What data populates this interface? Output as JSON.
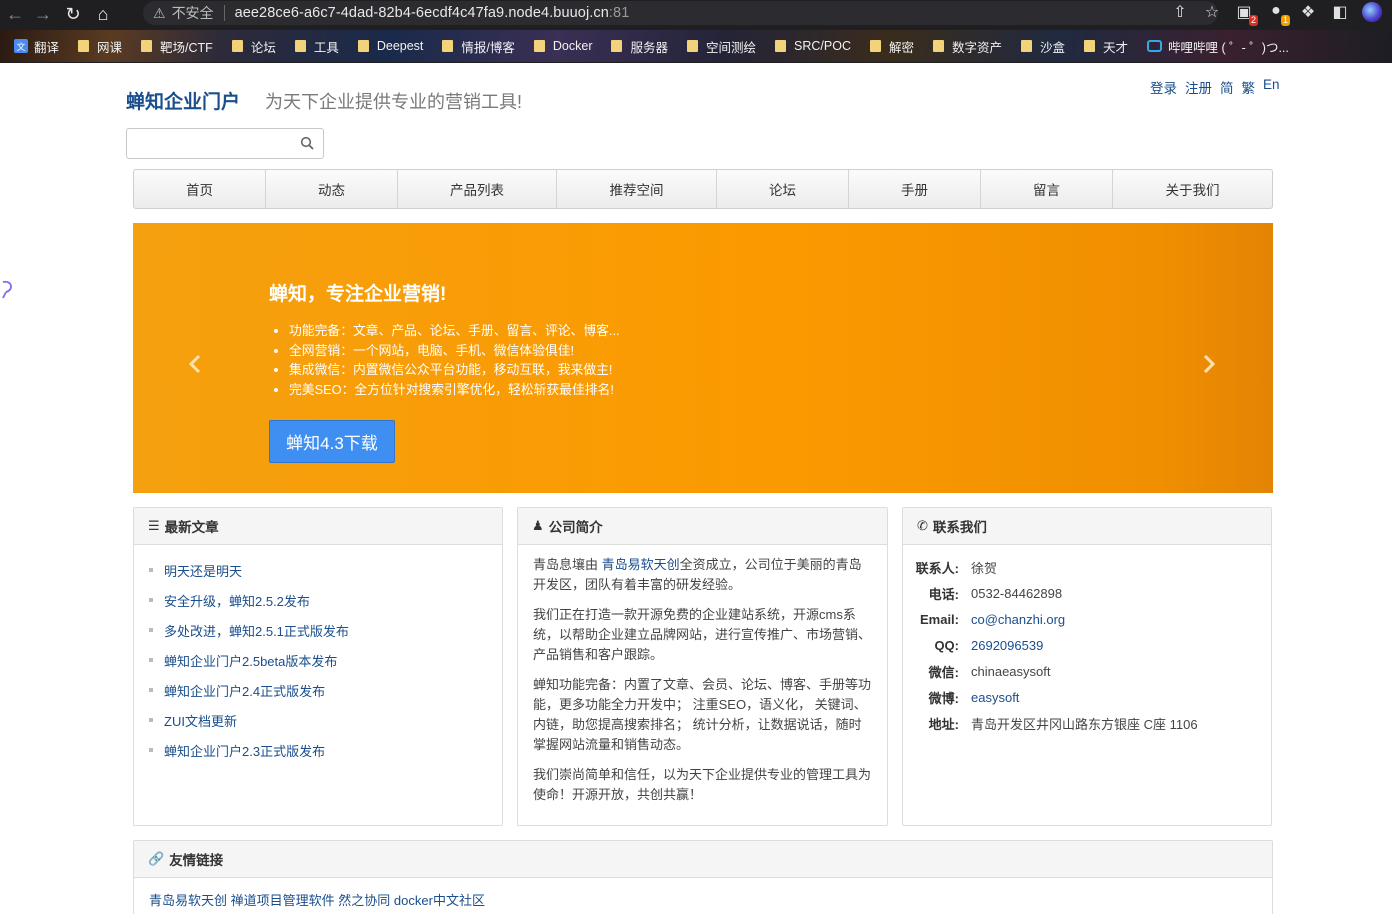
{
  "browser": {
    "address": {
      "insecure_label": "不安全",
      "url": "aee28ce6-a6c7-4dad-82b4-6ecdf4c47fa9.node4.buuoj.cn",
      "port": ":81"
    },
    "badges": {
      "ext1": "2",
      "ext2": "1"
    },
    "bookmarks": [
      {
        "label": "翻译",
        "icon": "translate-icon"
      },
      {
        "label": "网课",
        "icon": "folder-icon"
      },
      {
        "label": "靶场/CTF",
        "icon": "folder-icon"
      },
      {
        "label": "论坛",
        "icon": "folder-icon"
      },
      {
        "label": "工具",
        "icon": "folder-icon"
      },
      {
        "label": "Deepest",
        "icon": "folder-icon"
      },
      {
        "label": "情报/博客",
        "icon": "folder-icon"
      },
      {
        "label": "Docker",
        "icon": "folder-icon"
      },
      {
        "label": "服务器",
        "icon": "folder-icon"
      },
      {
        "label": "空间测绘",
        "icon": "folder-icon"
      },
      {
        "label": "SRC/POC",
        "icon": "folder-icon"
      },
      {
        "label": "解密",
        "icon": "folder-icon"
      },
      {
        "label": "数字资产",
        "icon": "folder-icon"
      },
      {
        "label": "沙盒",
        "icon": "folder-icon"
      },
      {
        "label": "天才",
        "icon": "folder-icon"
      },
      {
        "label": "哔哩哔哩 ( ゜- ゜)つ...",
        "icon": "bilibili-icon"
      }
    ]
  },
  "site": {
    "brand": "蝉知企业门户",
    "slogan": "为天下企业提供专业的营销工具!",
    "top_links": [
      "登录",
      "注册",
      "简",
      "繁",
      "En"
    ],
    "search": {
      "value": "",
      "placeholder": ""
    },
    "nav": [
      "首页",
      "动态",
      "产品列表",
      "推荐空间",
      "论坛",
      "手册",
      "留言",
      "关于我们"
    ],
    "banner": {
      "title": "蝉知，专注企业营销!",
      "bullets": [
        "功能完备：文章、产品、论坛、手册、留言、评论、博客...",
        "全网营销：一个网站，电脑、手机、微信体验俱佳!",
        "集成微信：内置微信公众平台功能，移动互联，我来做主!",
        "完美SEO：全方位针对搜索引擎优化，轻松斩获最佳排名!"
      ],
      "button": "蝉知4.3下载"
    },
    "articles": {
      "title": "最新文章",
      "items": [
        "明天还是明天",
        "安全升级，蝉知2.5.2发布",
        "多处改进，蝉知2.5.1正式版发布",
        "蝉知企业门户2.5beta版本发布",
        "蝉知企业门户2.4正式版发布",
        "ZUI文档更新",
        "蝉知企业门户2.3正式版发布"
      ]
    },
    "about": {
      "title": "公司简介",
      "p1_pre": "青岛息壤由 ",
      "p1_link": "青岛易软天创",
      "p1_post": "全资成立，公司位于美丽的青岛开发区，团队有着丰富的研发经验。",
      "p2": "我们正在打造一款开源免费的企业建站系统，开源cms系统，以帮助企业建立品牌网站，进行宣传推广、市场营销、产品销售和客户跟踪。",
      "p3": "蝉知功能完备：内置了文章、会员、论坛、博客、手册等功能，更多功能全力开发中； 注重SEO，语义化， 关键词、内链，助您提高搜索排名； 统计分析，让数据说话，随时掌握网站流量和销售动态。",
      "p4": "我们崇尚简单和信任，以为天下企业提供专业的管理工具为使命！开源开放，共创共赢！"
    },
    "contact": {
      "title": "联系我们",
      "rows": [
        {
          "k": "联系人:",
          "v": "徐贺"
        },
        {
          "k": "电话:",
          "v": "0532-84462898"
        },
        {
          "k": "Email:",
          "v": "co@chanzhi.org"
        },
        {
          "k": "QQ:",
          "v": "2692096539"
        },
        {
          "k": "微信:",
          "v": "chinaeasysoft"
        },
        {
          "k": "微博:",
          "v": "easysoft"
        },
        {
          "k": "地址:",
          "v": "青岛开发区井冈山路东方银座 C座 1106"
        }
      ]
    },
    "friend_links": {
      "title": "友情链接",
      "items": [
        "青岛易软天创",
        "禅道项目管理软件",
        "然之协同",
        "docker中文社区"
      ]
    }
  }
}
